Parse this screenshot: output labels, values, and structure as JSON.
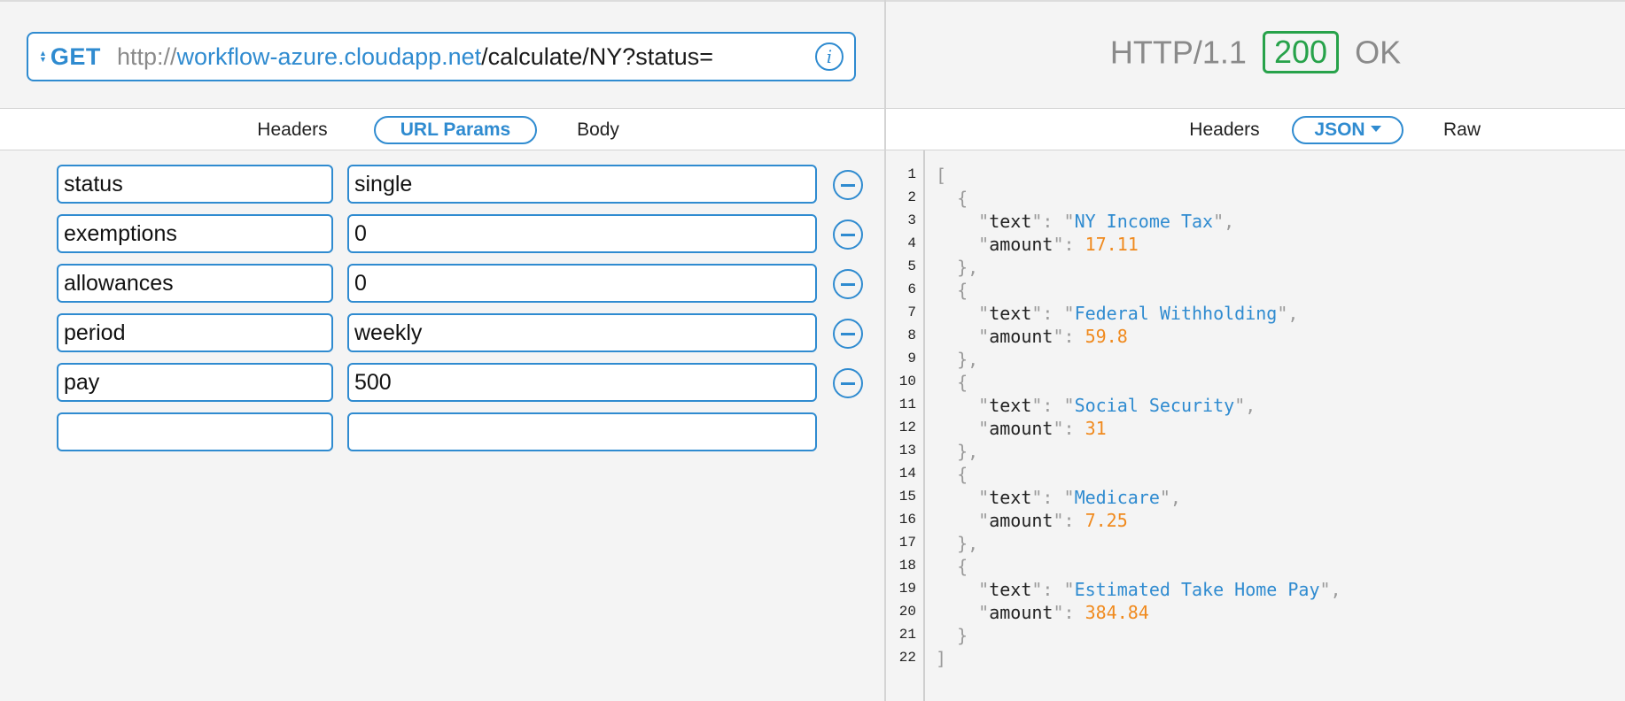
{
  "request": {
    "method": "GET",
    "url": {
      "scheme": "http://",
      "host": "workflow-azure.cloudapp.net",
      "path": "/calculate/NY?status="
    },
    "info_icon": "info-icon",
    "tabs": [
      {
        "label": "Headers",
        "active": false
      },
      {
        "label": "URL Params",
        "active": true
      },
      {
        "label": "Body",
        "active": false
      }
    ],
    "params": [
      {
        "key": "status",
        "value": "single"
      },
      {
        "key": "exemptions",
        "value": "0"
      },
      {
        "key": "allowances",
        "value": "0"
      },
      {
        "key": "period",
        "value": "weekly"
      },
      {
        "key": "pay",
        "value": "500"
      },
      {
        "key": "",
        "value": ""
      }
    ]
  },
  "response": {
    "protocol": "HTTP/1.1",
    "status_code": "200",
    "status_text": "OK",
    "tabs": [
      {
        "label": "Headers",
        "active": false
      },
      {
        "label": "JSON",
        "active": true,
        "dropdown": true
      },
      {
        "label": "Raw",
        "active": false
      }
    ],
    "body": [
      {
        "text": "NY Income Tax",
        "amount": "17.11"
      },
      {
        "text": "Federal Withholding",
        "amount": "59.8"
      },
      {
        "text": "Social Security",
        "amount": "31"
      },
      {
        "text": "Medicare",
        "amount": "7.25"
      },
      {
        "text": "Estimated Take Home Pay",
        "amount": "384.84"
      }
    ]
  },
  "colors": {
    "accent": "#2f8bd0",
    "success": "#27a24a",
    "number": "#f08a1e"
  }
}
